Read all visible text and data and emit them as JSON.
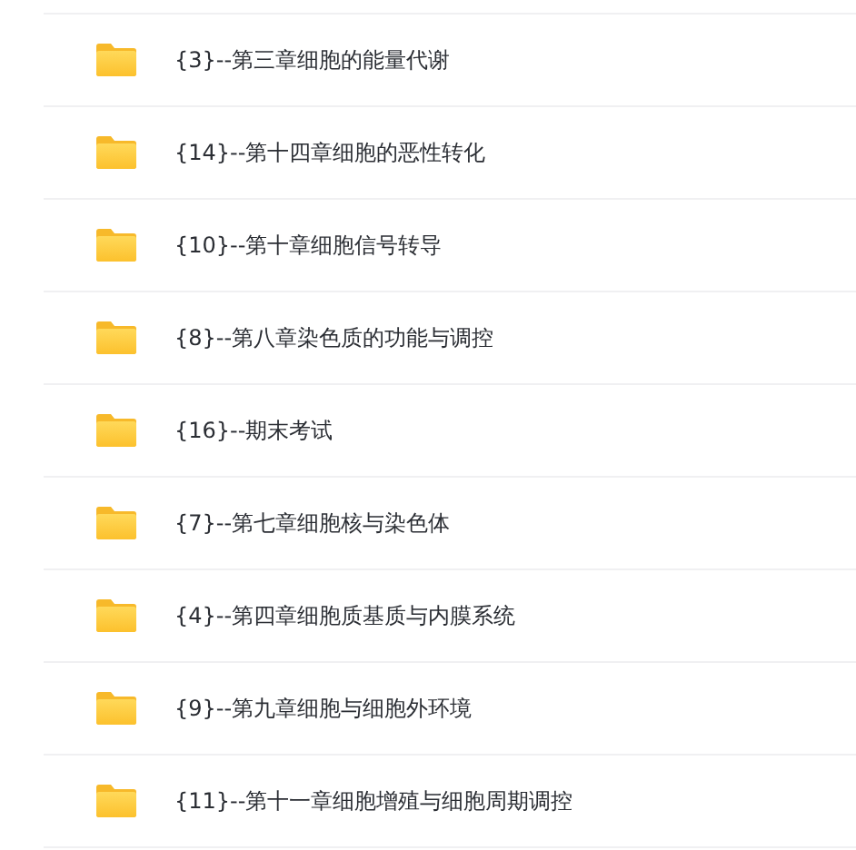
{
  "folders": [
    {
      "name": "{3}--第三章细胞的能量代谢"
    },
    {
      "name": "{14}--第十四章细胞的恶性转化"
    },
    {
      "name": "{10}--第十章细胞信号转导"
    },
    {
      "name": "{8}--第八章染色质的功能与调控"
    },
    {
      "name": "{16}--期末考试"
    },
    {
      "name": "{7}--第七章细胞核与染色体"
    },
    {
      "name": "{4}--第四章细胞质基质与内膜系统"
    },
    {
      "name": "{9}--第九章细胞与细胞外环境"
    },
    {
      "name": "{11}--第十一章细胞增殖与细胞周期调控"
    }
  ]
}
